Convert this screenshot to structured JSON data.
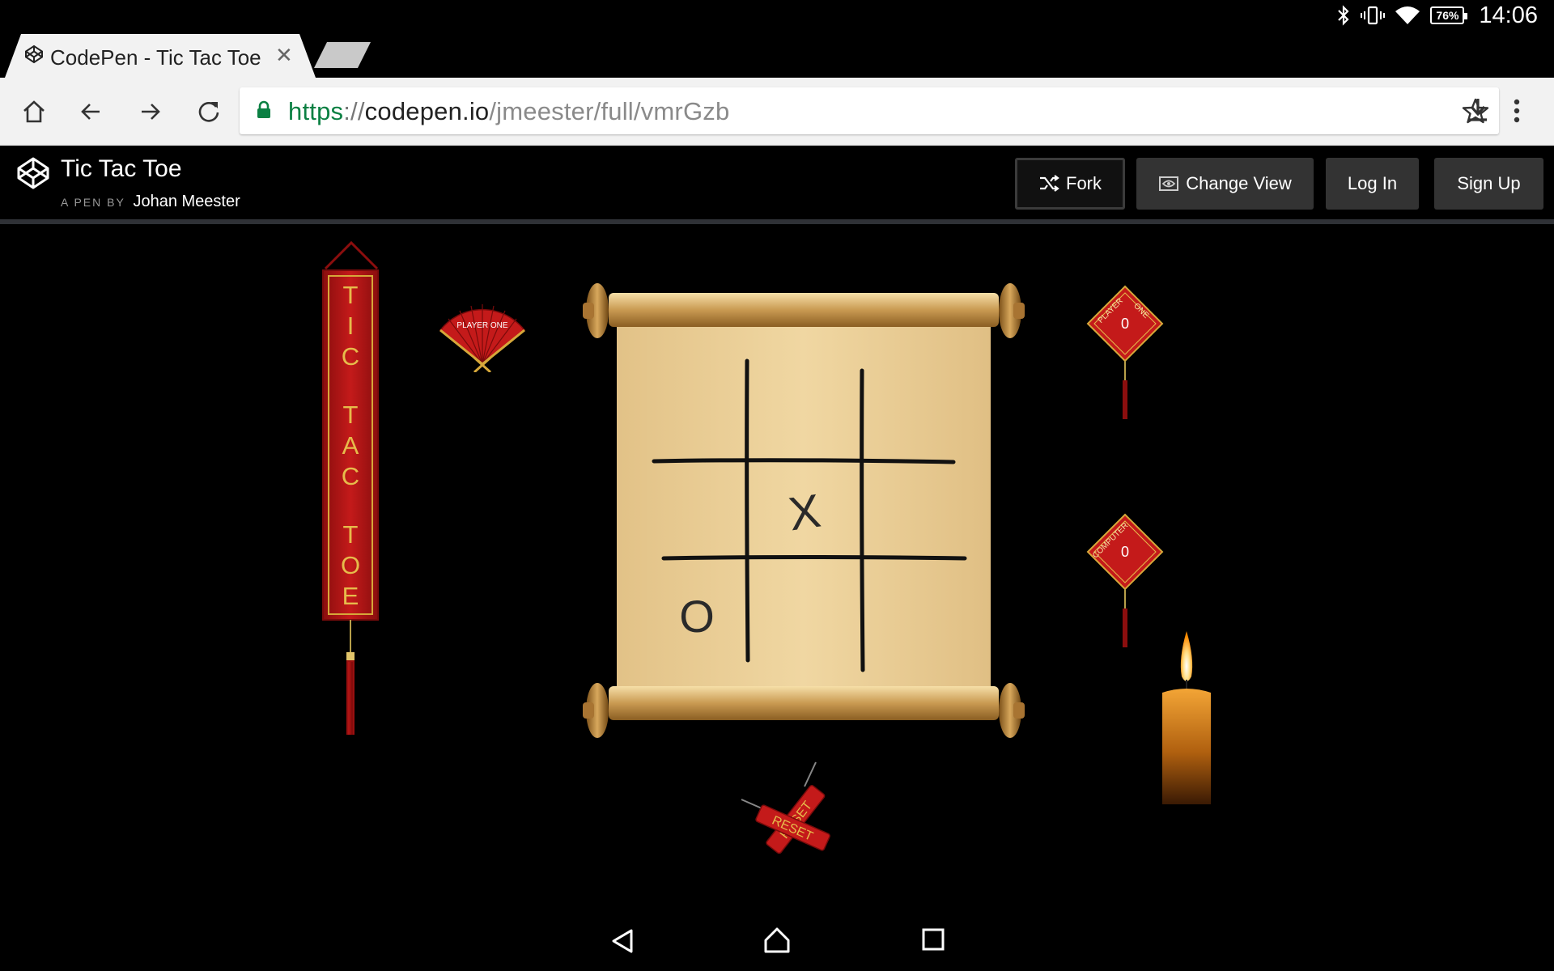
{
  "status": {
    "clock": "14:06",
    "battery_percent": "76%"
  },
  "browser": {
    "tab_title": "CodePen - Tic Tac Toe",
    "url": {
      "scheme": "https",
      "separator": "://",
      "host": "codepen.io",
      "path": "/jmeester/full/vmrGzb"
    }
  },
  "codepen": {
    "title": "Tic Tac Toe",
    "by_label": "A PEN BY",
    "author": "Johan Meester",
    "buttons": {
      "fork": "Fork",
      "change_view": "Change View",
      "log_in": "Log In",
      "sign_up": "Sign Up"
    }
  },
  "game": {
    "banner_letters": [
      "T",
      "I",
      "C",
      "T",
      "A",
      "C",
      "T",
      "O",
      "E"
    ],
    "fan_label": "PLAYER ONE",
    "scores": {
      "player_label_left": "PLAYER",
      "player_label_right": "ONE",
      "player_score": "0",
      "computer_label": "COMPUTER",
      "computer_score": "0"
    },
    "board": [
      [
        "",
        "",
        ""
      ],
      [
        "",
        "X",
        ""
      ],
      [
        "O",
        "",
        ""
      ]
    ],
    "reset_label": "RESET"
  },
  "colors": {
    "url_scheme": "#0b8043",
    "banner_red": "#c41a1a",
    "gold": "#e6bb4b",
    "parchment": "#eed49e"
  }
}
